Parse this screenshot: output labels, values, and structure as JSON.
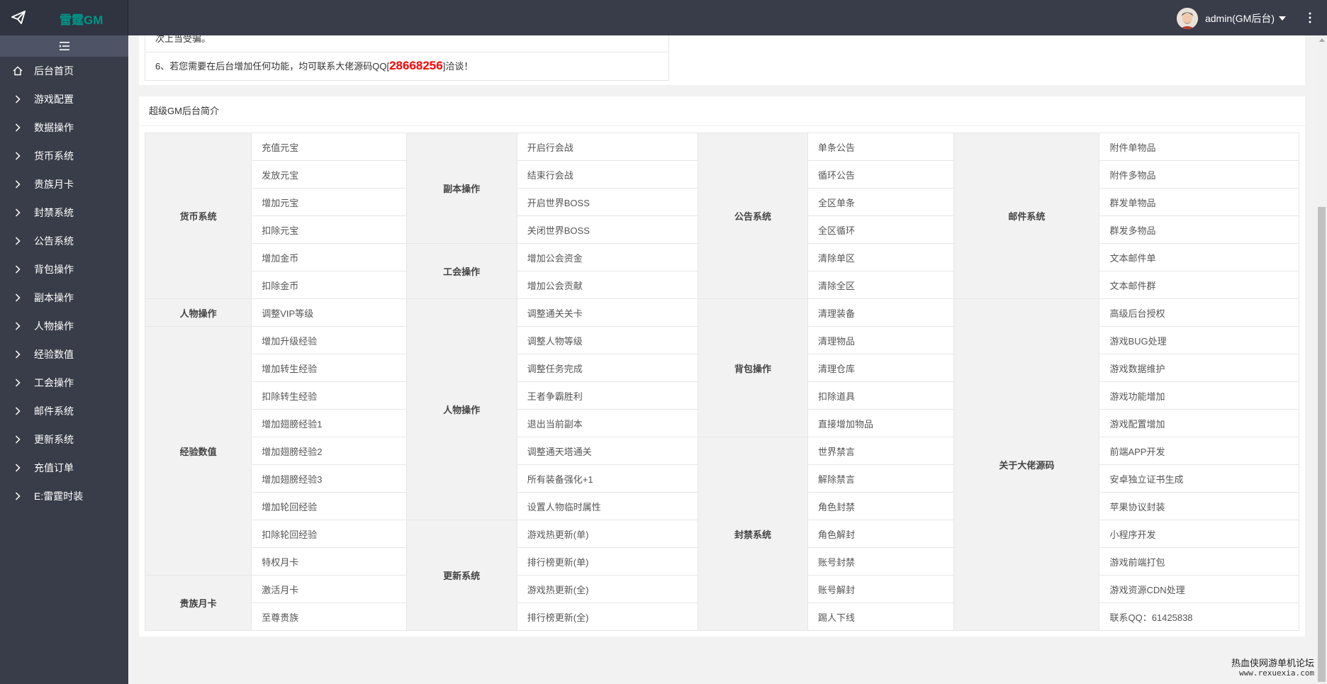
{
  "header": {
    "brand": "雷霆GM",
    "user_name": "admin(GM后台)",
    "icons": {
      "brand": "paper-plane-icon",
      "avatar": "user-avatar",
      "more": "vertical-dots-icon"
    }
  },
  "sidebar": {
    "toggle_icon": "menu-collapse-icon",
    "items": [
      {
        "label": "后台首页",
        "icon": "home-icon"
      },
      {
        "label": "游戏配置",
        "icon": "chevron-right-icon"
      },
      {
        "label": "数据操作",
        "icon": "chevron-right-icon"
      },
      {
        "label": "货币系统",
        "icon": "chevron-right-icon"
      },
      {
        "label": "贵族月卡",
        "icon": "chevron-right-icon"
      },
      {
        "label": "封禁系统",
        "icon": "chevron-right-icon"
      },
      {
        "label": "公告系统",
        "icon": "chevron-right-icon"
      },
      {
        "label": "背包操作",
        "icon": "chevron-right-icon"
      },
      {
        "label": "副本操作",
        "icon": "chevron-right-icon"
      },
      {
        "label": "人物操作",
        "icon": "chevron-right-icon"
      },
      {
        "label": "经验数值",
        "icon": "chevron-right-icon"
      },
      {
        "label": "工会操作",
        "icon": "chevron-right-icon"
      },
      {
        "label": "邮件系统",
        "icon": "chevron-right-icon"
      },
      {
        "label": "更新系统",
        "icon": "chevron-right-icon"
      },
      {
        "label": "充值订单",
        "icon": "chevron-right-icon"
      },
      {
        "label": "E:雷霆时装",
        "icon": "chevron-right-icon"
      }
    ]
  },
  "notice": {
    "partial_text": "次上当受骗。",
    "line6_prefix": "6、若您需要在后台增加任何功能，均可联系大佬源码QQ[",
    "qq": "28668256",
    "line6_suffix": "]洽谈！"
  },
  "intro": {
    "title": "超级GM后台简介",
    "groups": {
      "g1": [
        "货币系统",
        "人物操作",
        "经验数值",
        "贵族月卡"
      ],
      "g2": [
        "副本操作",
        "工会操作",
        "人物操作",
        "更新系统"
      ],
      "g3": [
        "公告系统",
        "背包操作",
        "封禁系统"
      ],
      "g4": [
        "邮件系统",
        "关于大佬源码"
      ]
    },
    "c1": [
      "充值元宝",
      "发放元宝",
      "增加元宝",
      "扣除元宝",
      "增加金币",
      "扣除金币",
      "调整VIP等级",
      "增加升级经验",
      "增加转生经验",
      "扣除转生经验",
      "增加翅膀经验1",
      "增加翅膀经验2",
      "增加翅膀经验3",
      "增加轮回经验",
      "扣除轮回经验",
      "特权月卡",
      "激活月卡",
      "至尊贵族"
    ],
    "c2": [
      "开启行会战",
      "结束行会战",
      "开启世界BOSS",
      "关闭世界BOSS",
      "增加公会资金",
      "增加公会贡献",
      "调整通关关卡",
      "调整人物等级",
      "调整任务完成",
      "王者争霸胜利",
      "退出当前副本",
      "调整通天塔通关",
      "所有装备强化+1",
      "设置人物临时属性",
      "游戏热更新(单)",
      "排行榜更新(单)",
      "游戏热更新(全)",
      "排行榜更新(全)"
    ],
    "c3": [
      "单条公告",
      "循环公告",
      "全区单条",
      "全区循环",
      "清除单区",
      "清除全区",
      "清理装备",
      "清理物品",
      "清理仓库",
      "扣除道具",
      "直接增加物品",
      "世界禁言",
      "解除禁言",
      "角色封禁",
      "角色解封",
      "账号封禁",
      "账号解封",
      "踢人下线"
    ],
    "c4": [
      "附件单物品",
      "附件多物品",
      "群发单物品",
      "群发多物品",
      "文本邮件单",
      "文本邮件群",
      "高级后台授权",
      "游戏BUG处理",
      "游戏数据维护",
      "游戏功能增加",
      "游戏配置增加",
      "前端APP开发",
      "安卓独立证书生成",
      "苹果协议封装",
      "小程序开发",
      "游戏前端打包",
      "游戏资源CDN处理",
      "联系QQ：61425838"
    ]
  },
  "watermark": {
    "line1": "热血侠网游单机论坛",
    "line2": "www.rexuexia.com"
  },
  "colors": {
    "sidebar_bg": "#393d49",
    "brand": "#009688",
    "qq_red": "#ff0000",
    "group_cell_bg": "#f2f2f2"
  }
}
